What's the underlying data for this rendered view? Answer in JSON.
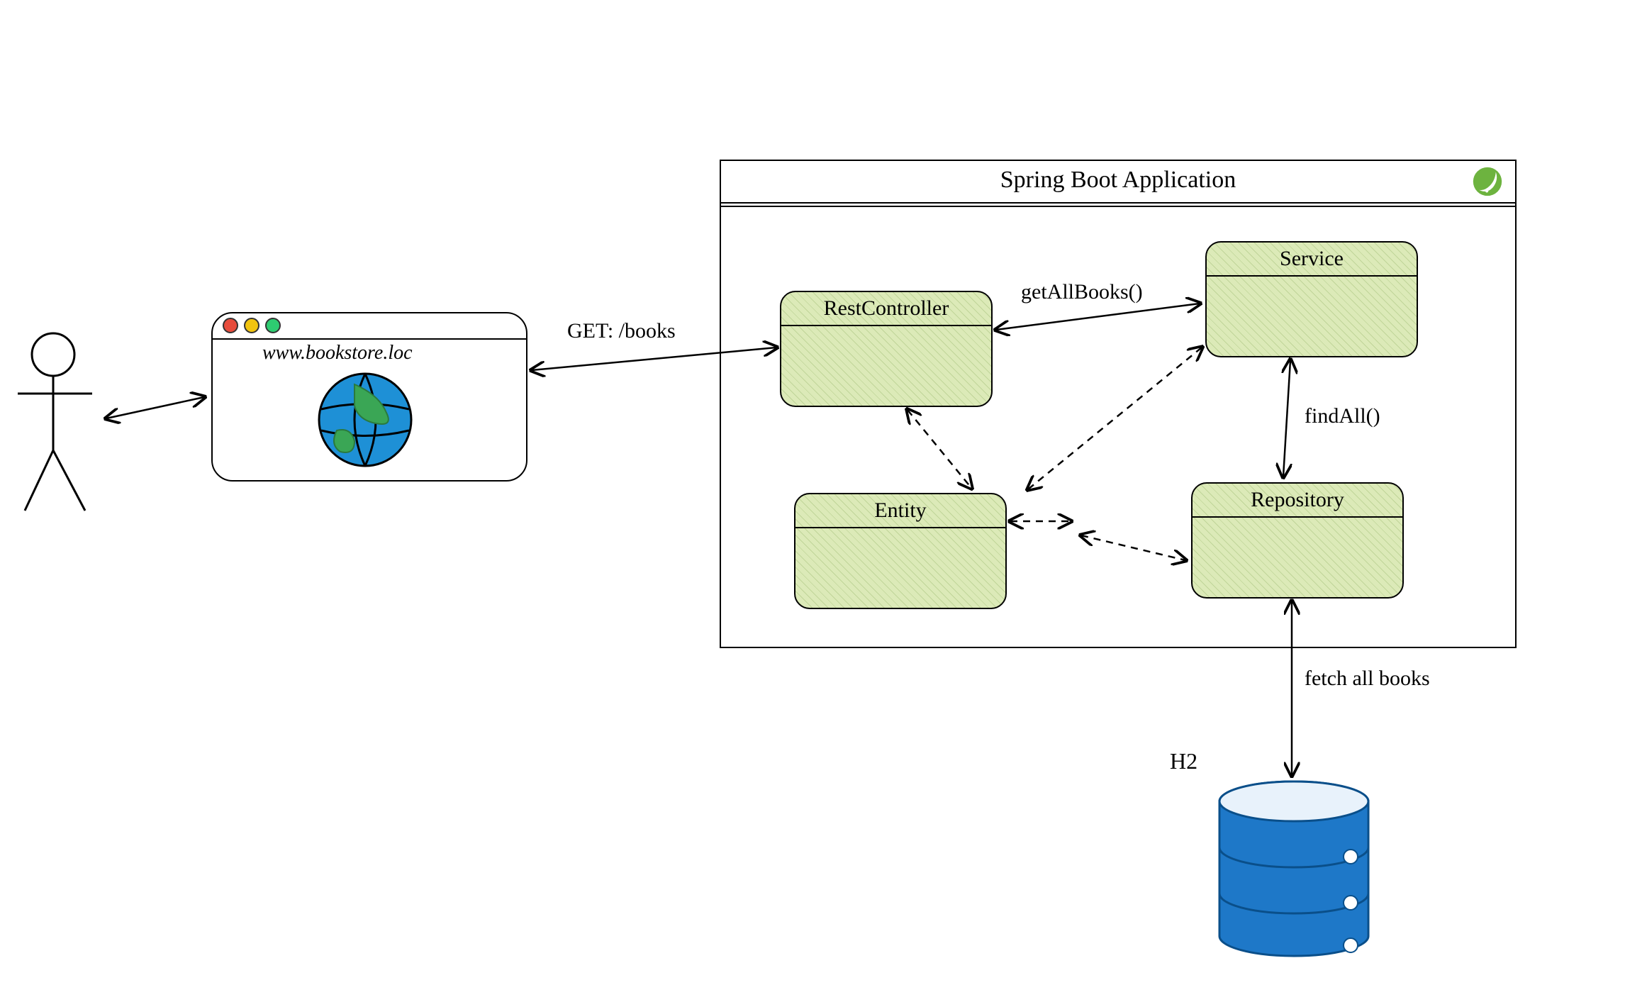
{
  "browser": {
    "url": "www.bookstore.loc"
  },
  "app": {
    "title": "Spring Boot Application",
    "logo_name": "spring-icon"
  },
  "components": {
    "rest_controller": "RestController",
    "service": "Service",
    "repository": "Repository",
    "entity": "Entity"
  },
  "arrows": {
    "http_request": "GET: /books",
    "controller_to_service": "getAllBooks()",
    "service_to_repository": "findAll()",
    "repository_to_db": "fetch all books"
  },
  "database": {
    "label": "H2"
  }
}
